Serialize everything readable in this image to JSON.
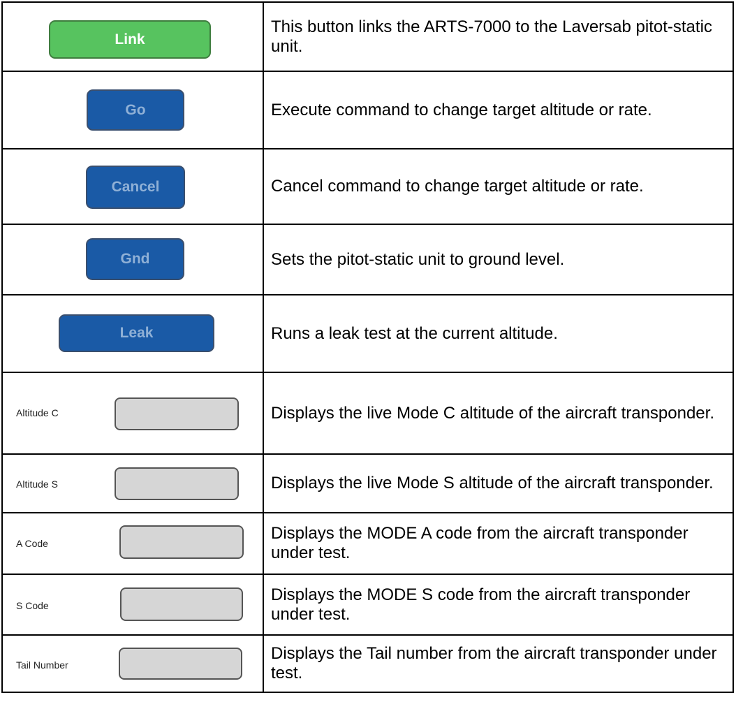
{
  "buttons": {
    "link": "Link",
    "go": "Go",
    "cancel": "Cancel",
    "gnd": "Gnd",
    "leak": "Leak"
  },
  "fields": {
    "altitude_c": "Altitude C",
    "altitude_s": "Altitude S",
    "a_code": "A Code",
    "s_code": "S Code",
    "tail_number": "Tail Number"
  },
  "descriptions": {
    "link": "This button links the ARTS-7000 to the Laversab pitot-static unit.",
    "go": "Execute command to change target altitude or rate.",
    "cancel": "Cancel command to change target altitude or rate.",
    "gnd": "Sets the pitot-static unit to ground level.",
    "leak": "Runs a leak test at the current altitude.",
    "altitude_c": "Displays the live Mode C altitude of the aircraft transponder.",
    "altitude_s": "Displays the live Mode S altitude of the aircraft transponder.",
    "a_code": "Displays the MODE A code from the aircraft transponder under test.",
    "s_code": "Displays the MODE S code from the aircraft transponder under test.",
    "tail_number": "Displays the Tail number from the aircraft transponder under test."
  },
  "colors": {
    "link_button": "#57c35f",
    "blue_button": "#1a5aa6",
    "field_fill": "#d6d6d6"
  }
}
